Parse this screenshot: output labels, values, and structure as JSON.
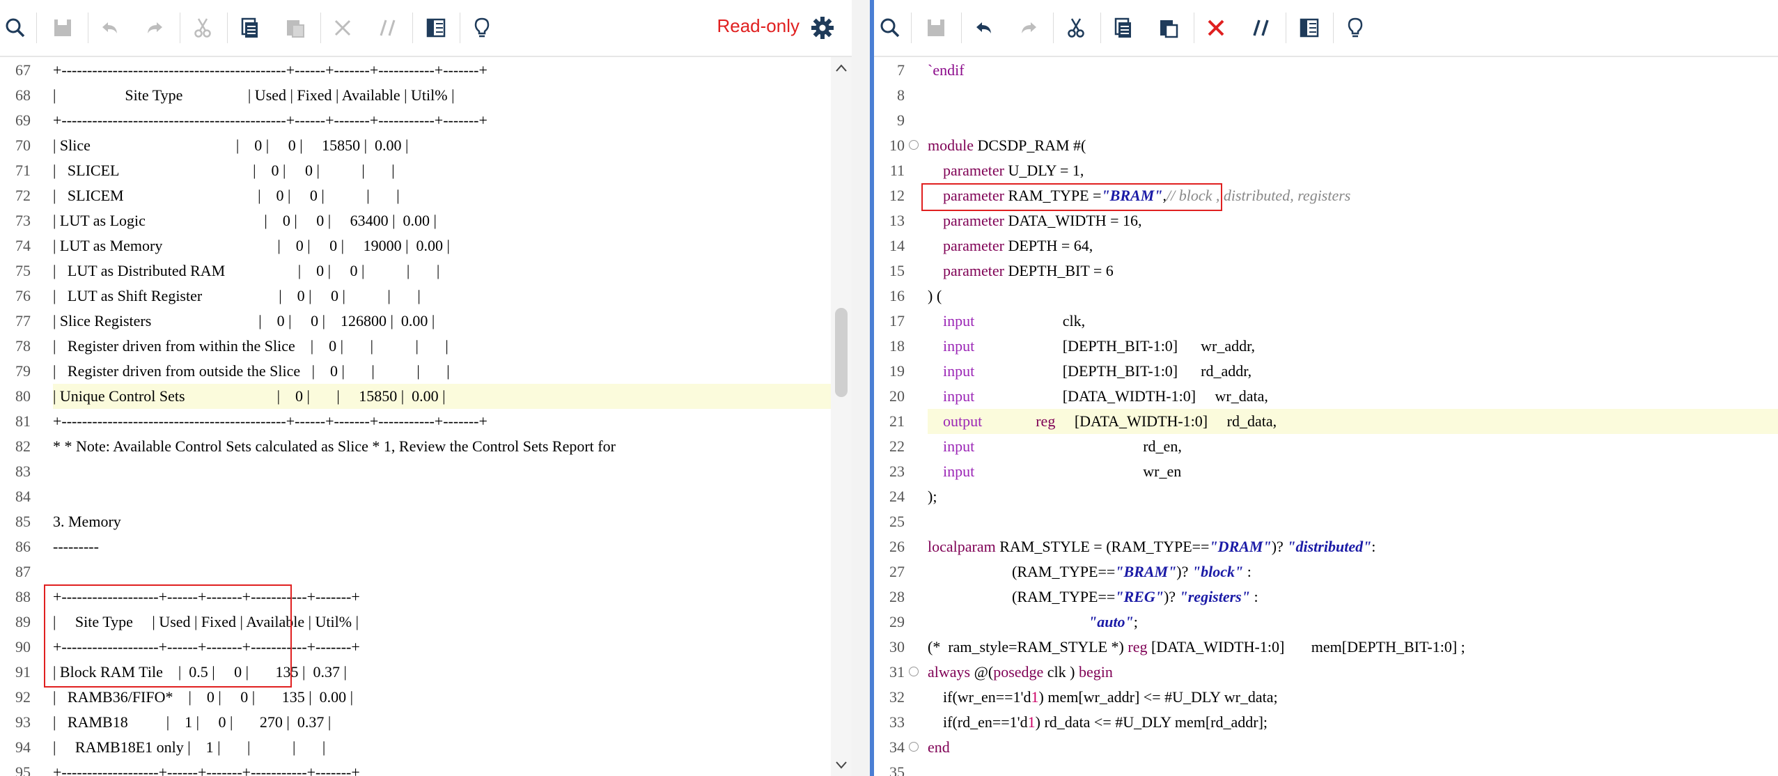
{
  "left": {
    "readonly_label": "Read-only",
    "toolbar_icons": [
      "search-icon",
      "save-icon",
      "undo-icon",
      "redo-icon",
      "cut-icon",
      "copy-icon",
      "paste-icon",
      "delete-icon",
      "comment-toggle-icon",
      "columns-icon",
      "lightbulb-icon"
    ],
    "lines": [
      {
        "n": "67",
        "t": "+--------------------------------------------+------+-------+-----------+-------+"
      },
      {
        "n": "68",
        "t": "|                  Site Type                 | Used | Fixed | Available | Util% |"
      },
      {
        "n": "69",
        "t": "+--------------------------------------------+------+-------+-----------+-------+"
      },
      {
        "n": "70",
        "t": "| Slice                                      |    0 |     0 |     15850 |  0.00 |"
      },
      {
        "n": "71",
        "t": "|   SLICEL                                   |    0 |     0 |           |       |"
      },
      {
        "n": "72",
        "t": "|   SLICEM                                   |    0 |     0 |           |       |"
      },
      {
        "n": "73",
        "t": "| LUT as Logic                               |    0 |     0 |     63400 |  0.00 |"
      },
      {
        "n": "74",
        "t": "| LUT as Memory                              |    0 |     0 |     19000 |  0.00 |"
      },
      {
        "n": "75",
        "t": "|   LUT as Distributed RAM                   |    0 |     0 |           |       |"
      },
      {
        "n": "76",
        "t": "|   LUT as Shift Register                    |    0 |     0 |           |       |"
      },
      {
        "n": "77",
        "t": "| Slice Registers                            |    0 |     0 |    126800 |  0.00 |"
      },
      {
        "n": "78",
        "t": "|   Register driven from within the Slice    |    0 |       |           |       |"
      },
      {
        "n": "79",
        "t": "|   Register driven from outside the Slice   |    0 |       |           |       |"
      },
      {
        "n": "80",
        "t": "| Unique Control Sets                        |    0 |       |     15850 |  0.00 |"
      },
      {
        "n": "81",
        "t": "+--------------------------------------------+------+-------+-----------+-------+"
      },
      {
        "n": "82",
        "t": "* * Note: Available Control Sets calculated as Slice * 1, Review the Control Sets Report for"
      },
      {
        "n": "83",
        "t": ""
      },
      {
        "n": "84",
        "t": ""
      },
      {
        "n": "85",
        "t": "3. Memory"
      },
      {
        "n": "86",
        "t": "---------"
      },
      {
        "n": "87",
        "t": ""
      },
      {
        "n": "88",
        "t": "+-------------------+------+-------+-----------+-------+"
      },
      {
        "n": "89",
        "t": "|     Site Type     | Used | Fixed | Available | Util% |"
      },
      {
        "n": "90",
        "t": "+-------------------+------+-------+-----------+-------+"
      },
      {
        "n": "91",
        "t": "| Block RAM Tile    |  0.5 |     0 |       135 |  0.37 |"
      },
      {
        "n": "92",
        "t": "|   RAMB36/FIFO*    |    0 |     0 |       135 |  0.00 |"
      },
      {
        "n": "93",
        "t": "|   RAMB18          |    1 |     0 |       270 |  0.37 |"
      },
      {
        "n": "94",
        "t": "|     RAMB18E1 only |    1 |       |           |       |"
      },
      {
        "n": "95",
        "t": "+-------------------+------+-------+-----------+-------+"
      }
    ]
  },
  "right": {
    "toolbar_icons": [
      "search-icon",
      "save-icon",
      "undo-icon",
      "redo-icon",
      "cut-icon",
      "copy-icon",
      "paste-icon",
      "delete-icon",
      "comment-toggle-icon",
      "columns-icon",
      "lightbulb-icon"
    ],
    "lines": [
      {
        "n": "7",
        "t": "`endif"
      },
      {
        "n": "8",
        "t": ""
      },
      {
        "n": "9",
        "t": ""
      },
      {
        "n": "10",
        "t": "module DCSDP_RAM #("
      },
      {
        "n": "11",
        "t": "    parameter U_DLY = 1,"
      },
      {
        "n": "12",
        "t": "    parameter RAM_TYPE =\"BRAM\",// block , distributed, registers"
      },
      {
        "n": "13",
        "t": "    parameter DATA_WIDTH = 16,"
      },
      {
        "n": "14",
        "t": "    parameter DEPTH = 64,"
      },
      {
        "n": "15",
        "t": "    parameter DEPTH_BIT = 6"
      },
      {
        "n": "16",
        "t": ") ("
      },
      {
        "n": "17",
        "t": "    input                       clk,"
      },
      {
        "n": "18",
        "t": "    input                       [DEPTH_BIT-1:0]      wr_addr,"
      },
      {
        "n": "19",
        "t": "    input                       [DEPTH_BIT-1:0]      rd_addr,"
      },
      {
        "n": "20",
        "t": "    input                       [DATA_WIDTH-1:0]     wr_data,"
      },
      {
        "n": "21",
        "t": "    output              reg     [DATA_WIDTH-1:0]     rd_data,"
      },
      {
        "n": "22",
        "t": "    input                                            rd_en,"
      },
      {
        "n": "23",
        "t": "    input                                            wr_en"
      },
      {
        "n": "24",
        "t": ");"
      },
      {
        "n": "25",
        "t": ""
      },
      {
        "n": "26",
        "t": "localparam RAM_STYLE = (RAM_TYPE==\"DRAM\")? \"distributed\":"
      },
      {
        "n": "27",
        "t": "                      (RAM_TYPE==\"BRAM\")? \"block\" :"
      },
      {
        "n": "28",
        "t": "                      (RAM_TYPE==\"REG\")? \"registers\" :"
      },
      {
        "n": "29",
        "t": "                                          \"auto\";"
      },
      {
        "n": "30",
        "t": "(*  ram_style=RAM_STYLE *) reg [DATA_WIDTH-1:0]       mem[DEPTH_BIT-1:0] ;"
      },
      {
        "n": "31",
        "t": "always @(posedge clk ) begin"
      },
      {
        "n": "32",
        "t": "    if(wr_en==1'd1) mem[wr_addr] <= #U_DLY wr_data;"
      },
      {
        "n": "33",
        "t": "    if(rd_en==1'd1) rd_data <= #U_DLY mem[rd_addr];"
      },
      {
        "n": "34",
        "t": "end"
      },
      {
        "n": "35",
        "t": ""
      }
    ]
  }
}
